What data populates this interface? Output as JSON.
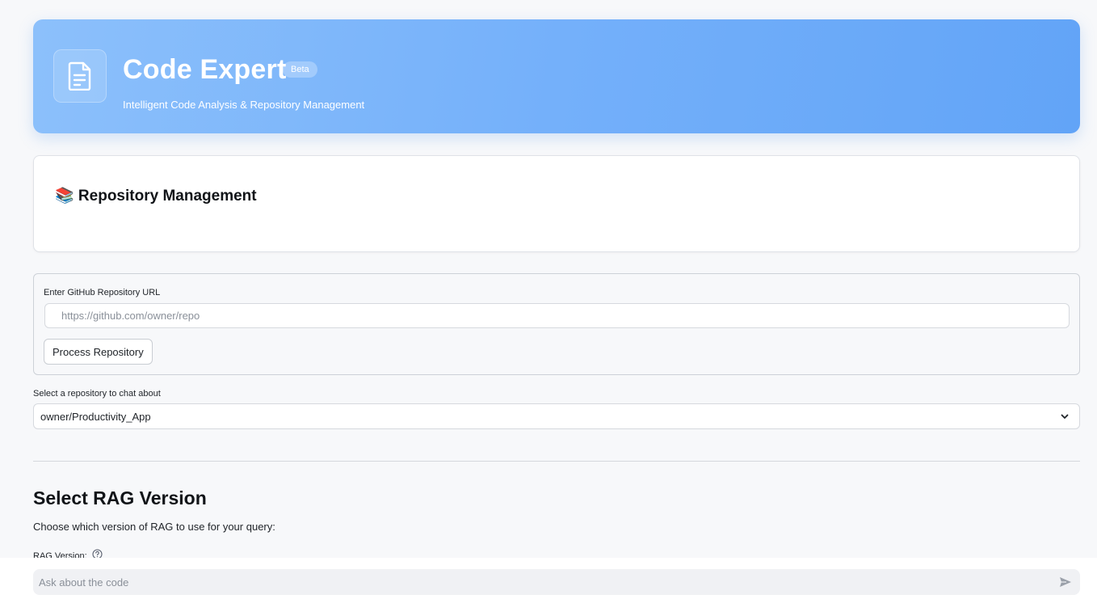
{
  "header": {
    "title": "Code Expert",
    "badge": "Beta",
    "subtitle": "Intelligent Code Analysis & Repository Management",
    "icon": "document-icon"
  },
  "repo_card": {
    "title": "📚 Repository Management"
  },
  "repo_form": {
    "label": "Enter GitHub Repository URL",
    "url_value": "",
    "url_placeholder": "https://github.com/owner/repo",
    "process_label": "Process Repository"
  },
  "repo_select": {
    "label": "Select a repository to chat about",
    "selected": "owner/Productivity_App",
    "icon": "chevron-down-icon"
  },
  "rag_section": {
    "title": "Select RAG Version",
    "description": "Choose which version of RAG to use for your query:",
    "version_label": "RAG Version:",
    "help_icon": "help-circle-icon"
  },
  "chat": {
    "placeholder": "Ask about the code",
    "value": "",
    "send_icon": "send-icon"
  },
  "colors": {
    "hero_start": "#8cc0fb",
    "hero_end": "#62a4f7",
    "background": "#f7f8fa"
  }
}
